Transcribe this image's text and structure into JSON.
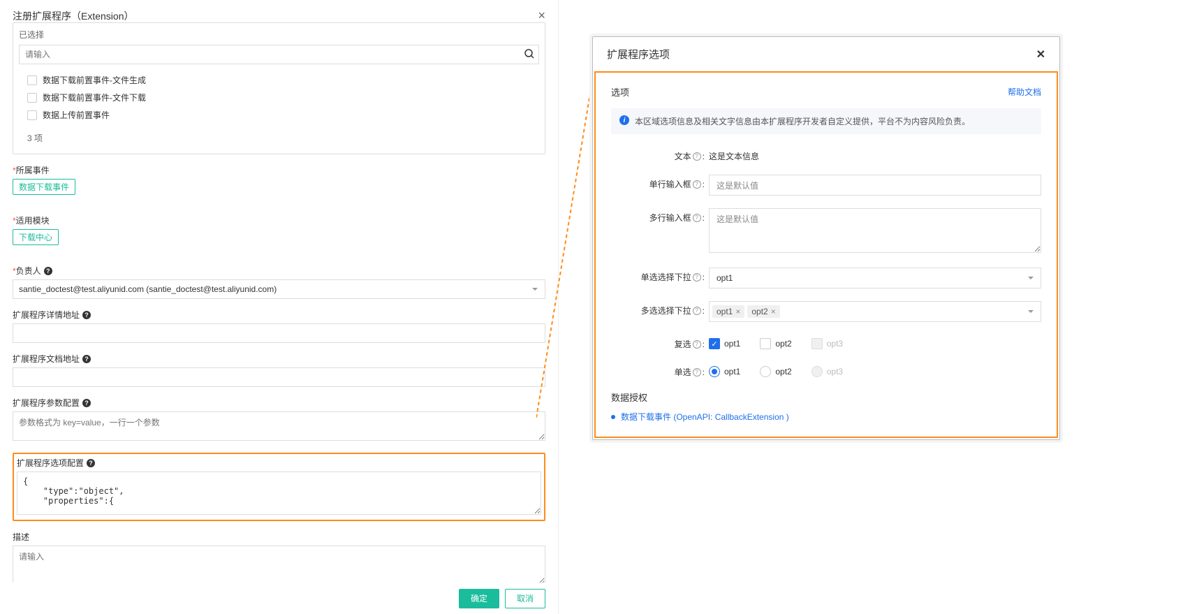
{
  "left": {
    "title": "注册扩展程序（Extension）",
    "selectedLabel": "已选择",
    "searchPlaceholder": "请输入",
    "checkItems": [
      "数据下载前置事件-文件生成",
      "数据下载前置事件-文件下载",
      "数据上传前置事件"
    ],
    "countText": "3 项",
    "belongEventLabel": "所属事件",
    "belongEventTag": "数据下载事件",
    "applicableModuleLabel": "适用模块",
    "applicableModuleTag": "下载中心",
    "ownerLabel": "负责人",
    "ownerValue": "santie_doctest@test.aliyunid.com (santie_doctest@test.aliyunid.com)",
    "detailUrlLabel": "扩展程序详情地址",
    "docUrlLabel": "扩展程序文档地址",
    "paramConfigLabel": "扩展程序参数配置",
    "paramConfigPlaceholder": "参数格式为 key=value，一行一个参数",
    "optionConfigLabel": "扩展程序选项配置",
    "optionConfigValue": "{\n    \"type\":\"object\",\n    \"properties\":{",
    "descLabel": "描述",
    "descPlaceholder": "请输入",
    "confirmBtn": "确定",
    "cancelBtn": "取消"
  },
  "right": {
    "title": "扩展程序选项",
    "sectionTitle": "选项",
    "helpLink": "帮助文档",
    "infoText": "本区域选项信息及相关文字信息由本扩展程序开发者自定义提供，平台不为内容风险负责。",
    "textLabel": "文本",
    "textValue": "这是文本信息",
    "singleInputLabel": "单行输入框",
    "singleInputValue": "这是默认值",
    "multiInputLabel": "多行输入框",
    "multiInputValue": "这是默认值",
    "singleSelectLabel": "单选选择下拉",
    "singleSelectValue": "opt1",
    "multiSelectLabel": "多选选择下拉",
    "multiSelectChips": [
      "opt1",
      "opt2"
    ],
    "checkboxLabel": "复选",
    "checkboxOpts": [
      {
        "label": "opt1",
        "checked": true,
        "disabled": false
      },
      {
        "label": "opt2",
        "checked": false,
        "disabled": false
      },
      {
        "label": "opt3",
        "checked": false,
        "disabled": true
      }
    ],
    "radioLabel": "单选",
    "radioOpts": [
      {
        "label": "opt1",
        "checked": true,
        "disabled": false
      },
      {
        "label": "opt2",
        "checked": false,
        "disabled": false
      },
      {
        "label": "opt3",
        "checked": false,
        "disabled": true
      }
    ],
    "authTitle": "数据授权",
    "authItem": "数据下载事件 (OpenAPI: CallbackExtension )"
  }
}
